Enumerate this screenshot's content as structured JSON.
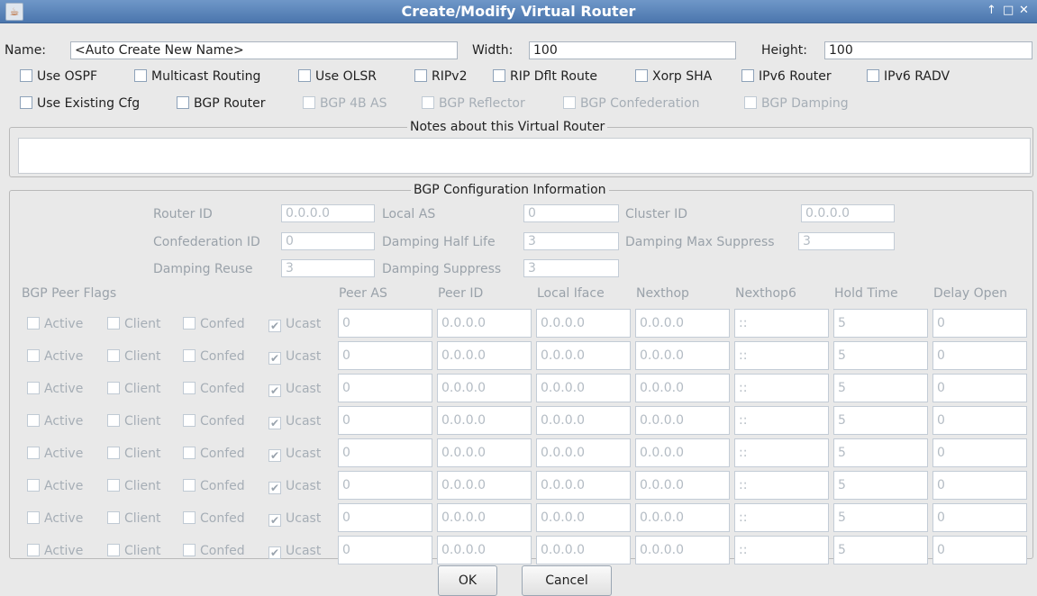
{
  "window": {
    "title": "Create/Modify Virtual Router",
    "controls": {
      "up": "↑",
      "maximize": "□",
      "close": "✕"
    },
    "icon": "java-cup-icon"
  },
  "form": {
    "name_label": "Name:",
    "name_value": "<Auto Create New Name>",
    "width_label": "Width:",
    "width_value": "100",
    "height_label": "Height:",
    "height_value": "100"
  },
  "options_row1": [
    {
      "label": "Use OSPF",
      "checked": false,
      "enabled": true
    },
    {
      "label": "Multicast Routing",
      "checked": false,
      "enabled": true
    },
    {
      "label": "Use OLSR",
      "checked": false,
      "enabled": true
    },
    {
      "label": "RIPv2",
      "checked": false,
      "enabled": true
    },
    {
      "label": "RIP Dflt Route",
      "checked": false,
      "enabled": true
    },
    {
      "label": "Xorp SHA",
      "checked": false,
      "enabled": true
    },
    {
      "label": "IPv6 Router",
      "checked": false,
      "enabled": true
    },
    {
      "label": "IPv6 RADV",
      "checked": false,
      "enabled": true
    }
  ],
  "options_row2": [
    {
      "label": "Use Existing Cfg",
      "checked": false,
      "enabled": true
    },
    {
      "label": "BGP Router",
      "checked": false,
      "enabled": true
    },
    {
      "label": "BGP 4B AS",
      "checked": false,
      "enabled": false
    },
    {
      "label": "BGP Reflector",
      "checked": false,
      "enabled": false
    },
    {
      "label": "BGP Confederation",
      "checked": false,
      "enabled": false
    },
    {
      "label": "BGP Damping",
      "checked": false,
      "enabled": false
    }
  ],
  "notes": {
    "title": "Notes about this Virtual Router",
    "value": ""
  },
  "bgp": {
    "title": "BGP Configuration Information",
    "router_id_label": "Router ID",
    "router_id_value": "0.0.0.0",
    "local_as_label": "Local AS",
    "local_as_value": "0",
    "cluster_id_label": "Cluster ID",
    "cluster_id_value": "0.0.0.0",
    "confed_id_label": "Confederation ID",
    "confed_id_value": "0",
    "damp_half_label": "Damping Half Life",
    "damp_half_value": "3",
    "damp_max_label": "Damping Max Suppress",
    "damp_max_value": "3",
    "damp_reuse_label": "Damping Reuse",
    "damp_reuse_value": "3",
    "damp_supp_label": "Damping Suppress",
    "damp_supp_value": "3"
  },
  "peers": {
    "headers": {
      "flags": "BGP Peer Flags",
      "peer_as": "Peer AS",
      "peer_id": "Peer ID",
      "local_iface": "Local Iface",
      "nexthop": "Nexthop",
      "nexthop6": "Nexthop6",
      "hold_time": "Hold Time",
      "delay_open": "Delay Open"
    },
    "flag_labels": {
      "active": "Active",
      "client": "Client",
      "confed": "Confed",
      "ucast": "Ucast"
    },
    "rows": [
      {
        "active": false,
        "client": false,
        "confed": false,
        "ucast": true,
        "peer_as": "0",
        "peer_id": "0.0.0.0",
        "local_iface": "0.0.0.0",
        "nexthop": "0.0.0.0",
        "nexthop6": "::",
        "hold_time": "5",
        "delay_open": "0"
      },
      {
        "active": false,
        "client": false,
        "confed": false,
        "ucast": true,
        "peer_as": "0",
        "peer_id": "0.0.0.0",
        "local_iface": "0.0.0.0",
        "nexthop": "0.0.0.0",
        "nexthop6": "::",
        "hold_time": "5",
        "delay_open": "0"
      },
      {
        "active": false,
        "client": false,
        "confed": false,
        "ucast": true,
        "peer_as": "0",
        "peer_id": "0.0.0.0",
        "local_iface": "0.0.0.0",
        "nexthop": "0.0.0.0",
        "nexthop6": "::",
        "hold_time": "5",
        "delay_open": "0"
      },
      {
        "active": false,
        "client": false,
        "confed": false,
        "ucast": true,
        "peer_as": "0",
        "peer_id": "0.0.0.0",
        "local_iface": "0.0.0.0",
        "nexthop": "0.0.0.0",
        "nexthop6": "::",
        "hold_time": "5",
        "delay_open": "0"
      },
      {
        "active": false,
        "client": false,
        "confed": false,
        "ucast": true,
        "peer_as": "0",
        "peer_id": "0.0.0.0",
        "local_iface": "0.0.0.0",
        "nexthop": "0.0.0.0",
        "nexthop6": "::",
        "hold_time": "5",
        "delay_open": "0"
      },
      {
        "active": false,
        "client": false,
        "confed": false,
        "ucast": true,
        "peer_as": "0",
        "peer_id": "0.0.0.0",
        "local_iface": "0.0.0.0",
        "nexthop": "0.0.0.0",
        "nexthop6": "::",
        "hold_time": "5",
        "delay_open": "0"
      },
      {
        "active": false,
        "client": false,
        "confed": false,
        "ucast": true,
        "peer_as": "0",
        "peer_id": "0.0.0.0",
        "local_iface": "0.0.0.0",
        "nexthop": "0.0.0.0",
        "nexthop6": "::",
        "hold_time": "5",
        "delay_open": "0"
      },
      {
        "active": false,
        "client": false,
        "confed": false,
        "ucast": true,
        "peer_as": "0",
        "peer_id": "0.0.0.0",
        "local_iface": "0.0.0.0",
        "nexthop": "0.0.0.0",
        "nexthop6": "::",
        "hold_time": "5",
        "delay_open": "0"
      }
    ]
  },
  "buttons": {
    "ok": "OK",
    "cancel": "Cancel"
  }
}
